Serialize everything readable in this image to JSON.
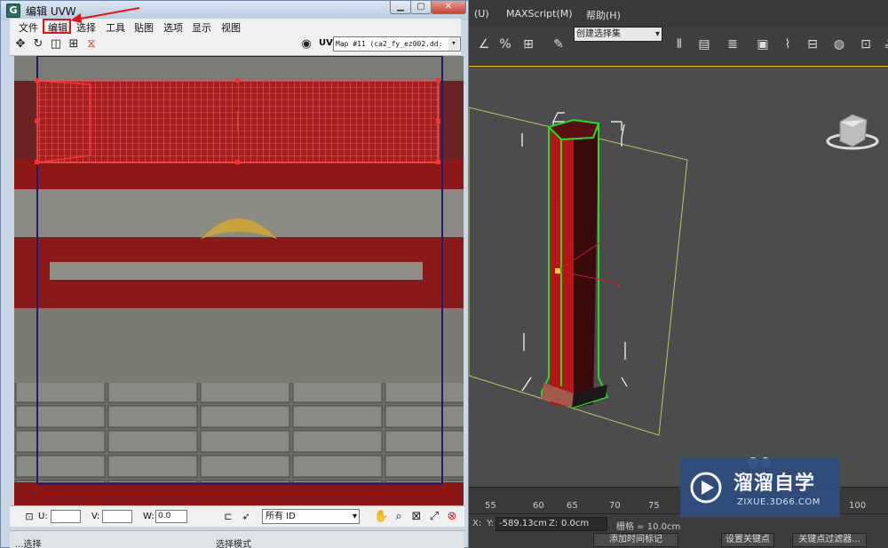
{
  "uvw_window": {
    "title": "编辑 UVW",
    "app_icon": "G",
    "menus": [
      "文件",
      "编辑",
      "选择",
      "工具",
      "贴图",
      "选项",
      "显示",
      "视图"
    ],
    "map_label": "UV",
    "map_dropdown": "Map #11 (ca2_fy_ez002.dd:",
    "bottom": {
      "u_label": "U:",
      "v_label": "V:",
      "w_label": "W:",
      "u_value": "",
      "v_value": "",
      "w_value": "0.0",
      "id_filter": "所有 ID"
    },
    "status_left": "...选择",
    "status_mode": "选择模式"
  },
  "max_window": {
    "menus": [
      "(U)",
      "MAXScript(M)",
      "帮助(H)"
    ],
    "named_selection_set": "创建选择集",
    "timeline_ticks": [
      "55",
      "60",
      "65",
      "70",
      "75",
      "100"
    ],
    "status": {
      "x_label": "X:",
      "y_label": "Y:",
      "y_value": "-589.13cm",
      "z_label": "Z:",
      "z_value": "0.0cm",
      "grid": "栅格 = 10.0cm",
      "add_time_tag": "添加时间标记",
      "set_key": "设置关键点",
      "key_filters": "关键点过滤器..."
    }
  },
  "watermark": {
    "title": "溜溜自学",
    "url": "ZIXUE.3D66.COM"
  },
  "colors": {
    "selection_red": "#e01414",
    "viewport_bg": "#4c4c4c",
    "object_green": "#22dd22"
  }
}
